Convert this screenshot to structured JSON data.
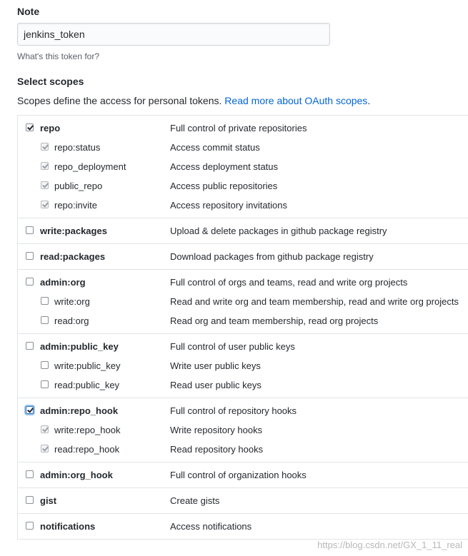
{
  "note": {
    "label": "Note",
    "value": "jenkins_token",
    "hint": "What's this token for?"
  },
  "scopes": {
    "title": "Select scopes",
    "description": "Scopes define the access for personal tokens.",
    "link_text": "Read more about OAuth scopes",
    "groups": [
      {
        "rows": [
          {
            "name": "repo",
            "desc": "Full control of private repositories"
          },
          {
            "name": "repo:status",
            "desc": "Access commit status"
          },
          {
            "name": "repo_deployment",
            "desc": "Access deployment status"
          },
          {
            "name": "public_repo",
            "desc": "Access public repositories"
          },
          {
            "name": "repo:invite",
            "desc": "Access repository invitations"
          }
        ]
      },
      {
        "rows": [
          {
            "name": "write:packages",
            "desc": "Upload & delete packages in github package registry"
          }
        ]
      },
      {
        "rows": [
          {
            "name": "read:packages",
            "desc": "Download packages from github package registry"
          }
        ]
      },
      {
        "rows": [
          {
            "name": "admin:org",
            "desc": "Full control of orgs and teams, read and write org projects"
          },
          {
            "name": "write:org",
            "desc": "Read and write org and team membership, read and write org projects"
          },
          {
            "name": "read:org",
            "desc": "Read org and team membership, read org projects"
          }
        ]
      },
      {
        "rows": [
          {
            "name": "admin:public_key",
            "desc": "Full control of user public keys"
          },
          {
            "name": "write:public_key",
            "desc": "Write user public keys"
          },
          {
            "name": "read:public_key",
            "desc": "Read user public keys"
          }
        ]
      },
      {
        "rows": [
          {
            "name": "admin:repo_hook",
            "desc": "Full control of repository hooks"
          },
          {
            "name": "write:repo_hook",
            "desc": "Write repository hooks"
          },
          {
            "name": "read:repo_hook",
            "desc": "Read repository hooks"
          }
        ]
      },
      {
        "rows": [
          {
            "name": "admin:org_hook",
            "desc": "Full control of organization hooks"
          }
        ]
      },
      {
        "rows": [
          {
            "name": "gist",
            "desc": "Create gists"
          }
        ]
      },
      {
        "rows": [
          {
            "name": "notifications",
            "desc": "Access notifications"
          }
        ]
      }
    ]
  },
  "watermark": "https://blog.csdn.net/GX_1_11_real"
}
